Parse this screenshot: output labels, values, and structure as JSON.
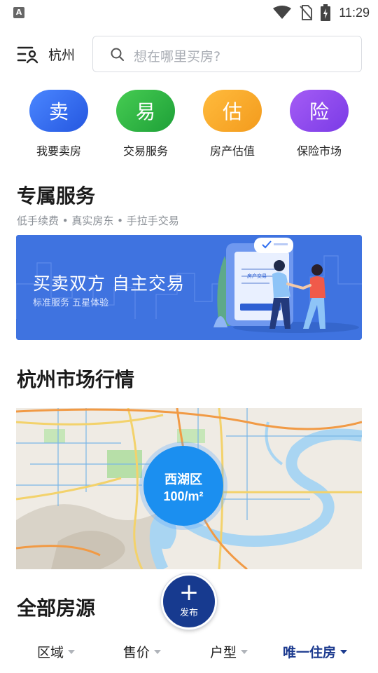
{
  "status_bar": {
    "time": "11:29",
    "notification_icon": "a-letter-icon",
    "icons": [
      "wifi-icon",
      "no-sim-icon",
      "battery-charging-icon"
    ]
  },
  "top_bar": {
    "city": "杭州",
    "search_placeholder": "想在哪里买房?"
  },
  "quick_actions": [
    {
      "glyph": "卖",
      "label": "我要卖房",
      "color": "#2f6ef0"
    },
    {
      "glyph": "易",
      "label": "交易服务",
      "color": "#25b33d"
    },
    {
      "glyph": "估",
      "label": "房产估值",
      "color": "#f7a325"
    },
    {
      "glyph": "险",
      "label": "保险市场",
      "color": "#8a47ee"
    }
  ],
  "exclusive_service": {
    "title": "专属服务",
    "subtitle": "低手续费 • 真实房东 • 手拉手交易",
    "banner": {
      "title": "买卖双方 自主交易",
      "subtitle": "标准服务  五星体验",
      "doc_label": "房产交易"
    }
  },
  "market": {
    "title": "杭州市场行情",
    "bubble_name": "西湖区",
    "bubble_price": "100/m²"
  },
  "listings": {
    "title": "全部房源"
  },
  "fab": {
    "label": "发布"
  },
  "filters": [
    {
      "label": "区域",
      "active": false
    },
    {
      "label": "售价",
      "active": false
    },
    {
      "label": "户型",
      "active": false
    },
    {
      "label": "唯一住房",
      "active": true
    }
  ],
  "colors": {
    "accent": "#1d3b8f",
    "banner_bg": "#3f73e0",
    "map_bubble": "#1b8ff0"
  }
}
